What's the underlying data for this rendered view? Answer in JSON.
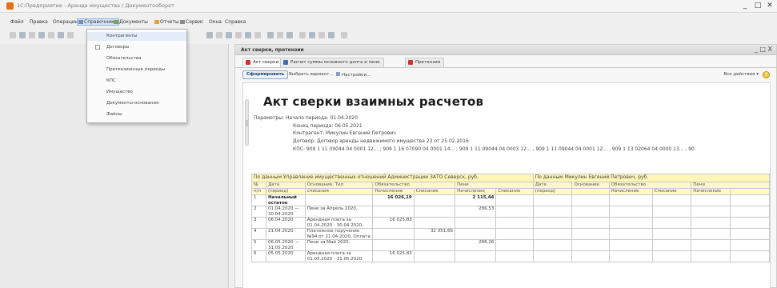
{
  "app": {
    "title": "1С:Предприятие - Аренда имущества / Документооборот"
  },
  "menubar": {
    "items": [
      "Файл",
      "Правка",
      "Операции",
      "Справочники",
      "Документы",
      "Отчеты",
      "Сервис",
      "Окна",
      "Справка"
    ]
  },
  "dropdown": {
    "items": [
      "Контрагенты",
      "Договоры",
      "Обязательства",
      "Претензионные периоды",
      "КПС",
      "Имущество",
      "Документы-основания",
      "Файлы"
    ]
  },
  "window": {
    "title": "Акт сверки, претензии",
    "controls": "_ □ X",
    "tabs": [
      "Акт сверки",
      "Расчет суммы основного долга и пени",
      "Претензия"
    ],
    "actions": {
      "generate": "Сформировать",
      "choose_variant": "Выбрать вариант...",
      "settings": "Настройки...",
      "all_actions": "Все действия ▾"
    }
  },
  "report": {
    "title": "Акт сверки взаимных расчетов",
    "params_label": "Параметры:",
    "params": [
      "Начало периода: 01.04.2020",
      "Конец периода: 06.05.2021",
      "Контрагент: Микулин Евгений Петрович",
      "Договор: Договор аренды недвижимого имущества 23 от 25.02.2016",
      "КПС: 909 1 11 09044 04 0001 12... ; 909 1 16 07090 04 0001 14... ; 909 1 11 09044 04 0003 12... , 909 1 11 09044 04 0001 12... , 909 1 13 02064 04 0000 13... , 90"
    ],
    "group_left": "По данным Управление имущественных отношений Администрации ЗАТО Северск, руб.",
    "group_right": "По данным Микулин Евгений Петрович, руб.",
    "headers": {
      "no": "№",
      "no2": "п/п",
      "date": "Дата",
      "date2": "(период)",
      "basis": "Основание, Тип",
      "basis2": "списания",
      "oblig": "Обязательство",
      "accrual": "Начисление",
      "writeoff": "Списание",
      "penalty": "Пени",
      "p_accrual": "Начисление",
      "p_writeoff": "Списание",
      "r_date": "Дата",
      "r_date2": "(период)",
      "r_basis": "Основание",
      "r_oblig": "Обязательство",
      "r_accrual": "Начисление",
      "r_writeoff": "Списание",
      "r_penalty": "Пени",
      "r_p_accrual": "Начисление"
    },
    "rows": [
      {
        "no": "1",
        "date": "Начальный остаток",
        "basis": "",
        "accrual": "16 026,19",
        "writeoff": "",
        "p_accrual": "2 115,44",
        "p_writeoff": ""
      },
      {
        "no": "2",
        "date": "01.04.2020 — 30.04.2020",
        "basis": "Пени за Апрель 2020,",
        "accrual": "",
        "writeoff": "",
        "p_accrual": "286,53",
        "p_writeoff": ""
      },
      {
        "no": "3",
        "date": "06.04.2020",
        "basis": "Арендная плата за 01.04.2020 - 30.04.2020,",
        "accrual": "16 025,83",
        "writeoff": "",
        "p_accrual": "",
        "p_writeoff": ""
      },
      {
        "no": "4",
        "date": "21.04.2020",
        "basis": "Платежное поручение №94 от 21.04.2020, Оплата",
        "accrual": "",
        "writeoff": "32 051,66",
        "p_accrual": "",
        "p_writeoff": ""
      },
      {
        "no": "5",
        "date": "06.05.2020 — 31.05.2020",
        "basis": "Пени за Май 2020,",
        "accrual": "",
        "writeoff": "",
        "p_accrual": "288,26",
        "p_writeoff": ""
      },
      {
        "no": "6",
        "date": "05.05.2020",
        "basis": "Арендная плата за 01.05.2020 - 31.05.2020",
        "accrual": "16 025,83",
        "writeoff": "",
        "p_accrual": "",
        "p_writeoff": ""
      }
    ]
  }
}
